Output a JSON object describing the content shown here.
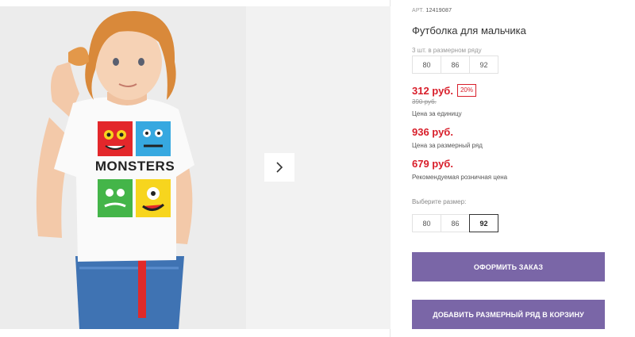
{
  "product": {
    "art_label": "АРТ.",
    "art_value": "12419087",
    "title": "Футболка для мальчика",
    "pack_text": "3 шт. в размерном ряду",
    "pack_sizes": [
      "80",
      "86",
      "92"
    ],
    "price": "312 руб.",
    "discount": "20%",
    "old_price": "390 руб.",
    "unit_price_label": "Цена за единицу",
    "row_price": "936 руб.",
    "row_price_label": "Цена за размерный ряд",
    "retail_price": "679 руб.",
    "retail_price_label": "Рекомендуемая розничная цена",
    "choose_size_label": "Выберите размер:",
    "choose_sizes": [
      "80",
      "86",
      "92"
    ],
    "selected_size": "92"
  },
  "buttons": {
    "order": "ОФОРМИТЬ ЗАКАЗ",
    "add_to_cart": "ДОБАВИТЬ РАЗМЕРНЫЙ РЯД В КОРЗИНУ"
  },
  "image": {
    "print_text": "MONSTERS"
  },
  "colors": {
    "accent": "#7a66a7",
    "price": "#d81e2a"
  },
  "icons": {
    "next": "chevron-right-icon"
  }
}
